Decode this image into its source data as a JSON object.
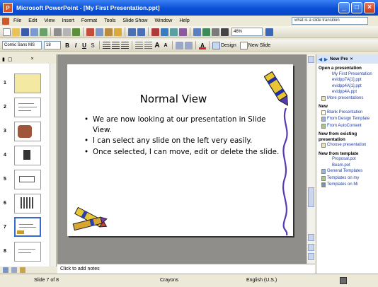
{
  "window": {
    "title": "Microsoft PowerPoint - [My First Presentation.ppt]",
    "app_icon": "P",
    "controls": [
      "_",
      "□",
      "×"
    ]
  },
  "menu": {
    "items": [
      "File",
      "Edit",
      "View",
      "Insert",
      "Format",
      "Tools",
      "Slide Show",
      "Window",
      "Help"
    ],
    "ask_placeholder": "what is a slide transition"
  },
  "toolbar_standard": {
    "zoom": "46%"
  },
  "toolbar_formatting": {
    "font": "Comic Sans MS",
    "size": "18",
    "bold": "B",
    "italic": "I",
    "underline": "U",
    "shadow": "S",
    "design_label": "Design",
    "new_slide_label": "New Slide"
  },
  "slides_pane": {
    "tabs": [
      "▮",
      "▢",
      "×"
    ],
    "thumbnails": [
      {
        "number": "1"
      },
      {
        "number": "2"
      },
      {
        "number": "3"
      },
      {
        "number": "4"
      },
      {
        "number": "5"
      },
      {
        "number": "6"
      },
      {
        "number": "7",
        "selected": true
      },
      {
        "number": "8"
      }
    ]
  },
  "slide": {
    "title": "Normal View",
    "bullets": [
      "We are now looking at our presentation in Slide View.",
      "I can select any slide on the left very easily.",
      "Once selected, I can move, edit or delete the slide."
    ]
  },
  "notes": {
    "placeholder": "Click to add notes"
  },
  "task_pane": {
    "title": "New Pre",
    "sections": [
      {
        "heading": "Open a presentation",
        "items": [
          "My First Presentation",
          "evidpp7A[1].ppt",
          "evidpp4A[1].ppt",
          "evidpp4A.ppt",
          "More presentations"
        ]
      },
      {
        "heading": "New",
        "items": [
          "Blank Presentation",
          "From Design Template",
          "From AutoContent"
        ]
      },
      {
        "heading": "New from existing presentation",
        "items": [
          "Choose presentation"
        ]
      },
      {
        "heading": "New from template",
        "items": [
          "Proposal.pot",
          "Beam.pot",
          "General Templates",
          "Templates on my",
          "Templates on Mi"
        ]
      }
    ]
  },
  "status": {
    "slide": "Slide 7 of 8",
    "design": "Crayons",
    "language": "English (U.S.)"
  },
  "colors": {
    "titlebar": "#0a4fd6",
    "link": "#1f3ea5",
    "selection": "#3a6ac9",
    "slide_bg": "#8f8e8a"
  }
}
